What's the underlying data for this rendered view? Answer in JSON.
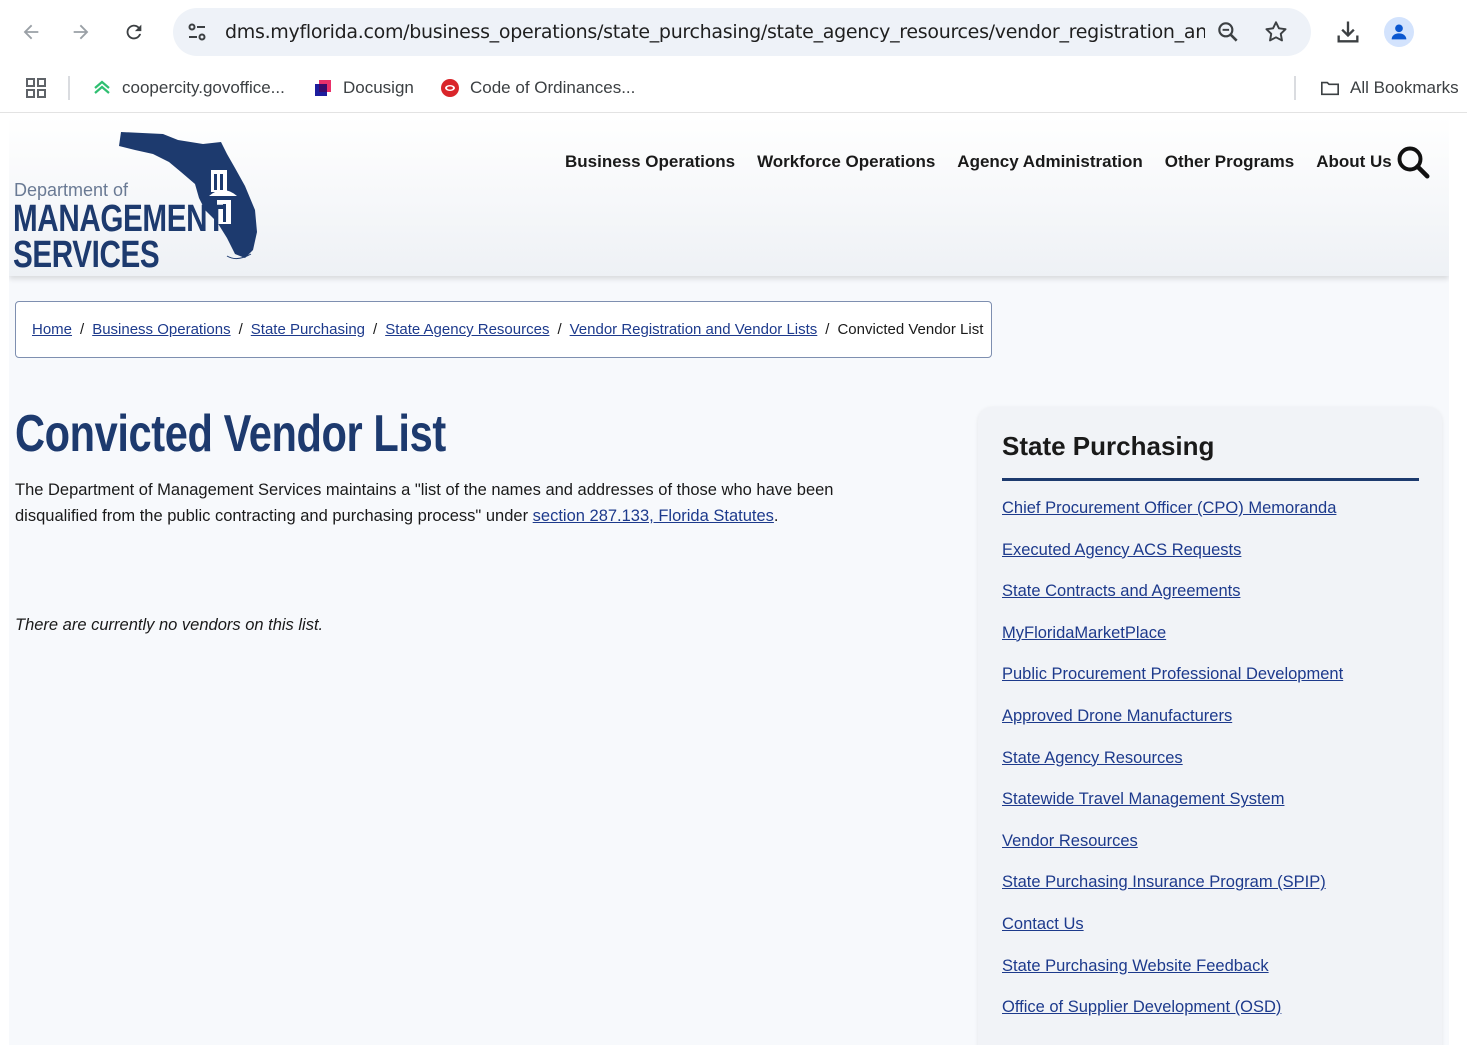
{
  "browser": {
    "url": "dms.myflorida.com/business_operations/state_purchasing/state_agency_resources/vendor_registration_and...",
    "bookmarks": [
      {
        "label": "coopercity.govoffice..."
      },
      {
        "label": "Docusign"
      },
      {
        "label": "Code of Ordinances..."
      }
    ],
    "all_bookmarks_label": "All Bookmarks"
  },
  "header": {
    "logo_line1": "Department of",
    "logo_line2": "MANAGEMENT",
    "logo_line3": "SERVICES",
    "nav": [
      "Business Operations",
      "Workforce Operations",
      "Agency Administration",
      "Other Programs",
      "About Us"
    ]
  },
  "breadcrumb": {
    "links": [
      "Home",
      "Business Operations",
      "State Purchasing",
      "State Agency Resources",
      "Vendor Registration and Vendor Lists"
    ],
    "current": "Convicted Vendor List"
  },
  "main": {
    "title": "Convicted Vendor List",
    "intro_text": "The Department of Management Services maintains a \"list of the names and addresses of those who have been disqualified from the public contracting and purchasing process\" under ",
    "intro_link": "section 287.133, Florida Statutes",
    "intro_end": ".",
    "empty_note": "There are currently no vendors on this list."
  },
  "sidebar": {
    "title": "State Purchasing",
    "links": [
      "Chief Procurement Officer (CPO) Memoranda",
      "Executed Agency ACS Requests",
      "State Contracts and Agreements",
      "MyFloridaMarketPlace",
      "Public Procurement Professional Development",
      "Approved Drone Manufacturers",
      "State Agency Resources",
      "Statewide Travel Management System",
      "Vendor Resources",
      "State Purchasing Insurance Program (SPIP)",
      "Contact Us",
      "State Purchasing Website Feedback",
      "Office of Supplier Development (OSD)"
    ]
  },
  "colors": {
    "brand_navy": "#1d3a6e",
    "link_blue": "#1d3a8c"
  }
}
